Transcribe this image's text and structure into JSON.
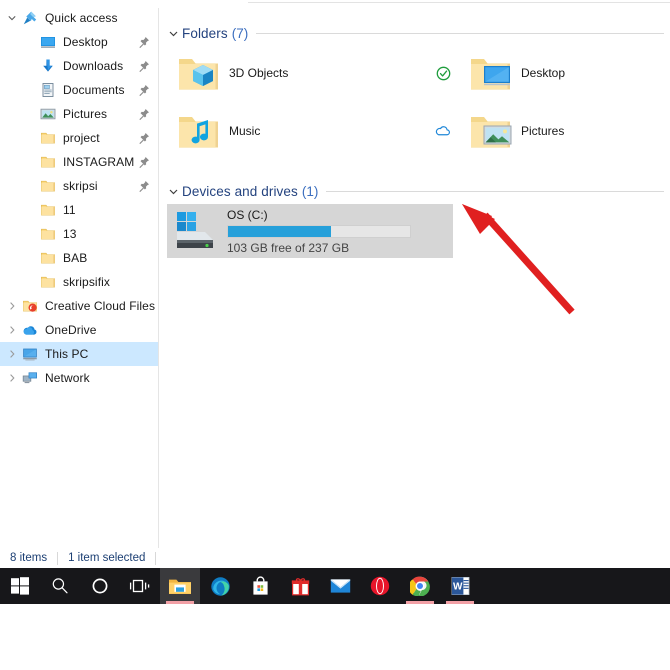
{
  "sidebar": {
    "items": [
      {
        "label": "Quick access",
        "icon": "star-pin-icon",
        "level": 0,
        "chevron": "down",
        "pinned": false,
        "selected": false
      },
      {
        "label": "Desktop",
        "icon": "desktop-icon",
        "level": 1,
        "chevron": "none",
        "pinned": true,
        "selected": false
      },
      {
        "label": "Downloads",
        "icon": "downloads-icon",
        "level": 1,
        "chevron": "none",
        "pinned": true,
        "selected": false
      },
      {
        "label": "Documents",
        "icon": "documents-icon",
        "level": 1,
        "chevron": "none",
        "pinned": true,
        "selected": false
      },
      {
        "label": "Pictures",
        "icon": "pictures-icon",
        "level": 1,
        "chevron": "none",
        "pinned": true,
        "selected": false
      },
      {
        "label": "project",
        "icon": "folder-icon",
        "level": 1,
        "chevron": "none",
        "pinned": true,
        "selected": false
      },
      {
        "label": "INSTAGRAM",
        "icon": "folder-icon",
        "level": 1,
        "chevron": "none",
        "pinned": true,
        "selected": false
      },
      {
        "label": "skripsi",
        "icon": "folder-icon",
        "level": 1,
        "chevron": "none",
        "pinned": true,
        "selected": false
      },
      {
        "label": "11",
        "icon": "folder-icon",
        "level": 1,
        "chevron": "none",
        "pinned": false,
        "selected": false
      },
      {
        "label": "13",
        "icon": "folder-icon",
        "level": 1,
        "chevron": "none",
        "pinned": false,
        "selected": false
      },
      {
        "label": "BAB",
        "icon": "folder-icon",
        "level": 1,
        "chevron": "none",
        "pinned": false,
        "selected": false
      },
      {
        "label": "skripsifix",
        "icon": "folder-icon",
        "level": 1,
        "chevron": "none",
        "pinned": false,
        "selected": false
      },
      {
        "label": "Creative Cloud Files",
        "icon": "creative-cloud-icon",
        "level": 0,
        "chevron": "right",
        "pinned": false,
        "selected": false
      },
      {
        "label": "OneDrive",
        "icon": "onedrive-icon",
        "level": 0,
        "chevron": "right",
        "pinned": false,
        "selected": false
      },
      {
        "label": "This PC",
        "icon": "this-pc-icon",
        "level": 0,
        "chevron": "right",
        "pinned": false,
        "selected": true
      },
      {
        "label": "Network",
        "icon": "network-icon",
        "level": 0,
        "chevron": "right",
        "pinned": false,
        "selected": false
      }
    ]
  },
  "content": {
    "groups": [
      {
        "title": "Folders",
        "count": "(7)",
        "collapsed": false
      },
      {
        "title": "Devices and drives",
        "count": "(1)",
        "collapsed": false
      }
    ],
    "folders": [
      {
        "name": "3D Objects",
        "icon": "folder-3d-objects-icon",
        "cloud_status": "none"
      },
      {
        "name": "Desktop",
        "icon": "folder-desktop-icon",
        "cloud_status": "synced-check"
      },
      {
        "name": "Music",
        "icon": "folder-music-icon",
        "cloud_status": "none"
      },
      {
        "name": "Pictures",
        "icon": "folder-pictures-icon",
        "cloud_status": "online-only-cloud"
      }
    ],
    "drives": [
      {
        "name": "OS (C:)",
        "icon": "windows-hard-drive-icon",
        "free_text": "103 GB free of 237 GB",
        "free_gb": 103,
        "total_gb": 237,
        "used_percent": 56.5,
        "selected": true
      }
    ]
  },
  "status_bar": {
    "item_count": "8 items",
    "selection_count": "1 item selected"
  },
  "annotation": {
    "type": "red-arrow",
    "color": "#e02020",
    "points_to": "OS (C:) drive tile"
  },
  "taskbar": {
    "items": [
      {
        "name": "start-button",
        "icon": "windows-logo-icon",
        "active": false,
        "running": false
      },
      {
        "name": "search-button",
        "icon": "search-icon",
        "active": false,
        "running": false
      },
      {
        "name": "cortana-button",
        "icon": "cortana-circle-icon",
        "active": false,
        "running": false
      },
      {
        "name": "task-view-button",
        "icon": "task-view-icon",
        "active": false,
        "running": false
      },
      {
        "name": "file-explorer-button",
        "icon": "file-explorer-icon",
        "active": true,
        "running": true
      },
      {
        "name": "edge-button",
        "icon": "edge-icon",
        "active": false,
        "running": false
      },
      {
        "name": "microsoft-store-button",
        "icon": "store-bag-icon",
        "active": false,
        "running": false
      },
      {
        "name": "gift-app-button",
        "icon": "gift-box-icon",
        "active": false,
        "running": false
      },
      {
        "name": "mail-button",
        "icon": "mail-envelope-icon",
        "active": false,
        "running": false
      },
      {
        "name": "opera-button",
        "icon": "opera-icon",
        "active": false,
        "running": false
      },
      {
        "name": "chrome-button",
        "icon": "chrome-icon",
        "active": false,
        "running": true
      },
      {
        "name": "word-button",
        "icon": "word-icon",
        "active": false,
        "running": true
      }
    ]
  },
  "colors": {
    "selection_blue": "#cce8ff",
    "tile_selected_gray": "#d6d6d6",
    "progress_blue": "#26a0da",
    "group_header_blue": "#24437f",
    "status_text_blue": "#1c3f73",
    "taskbar_bg": "#17171a",
    "annotation_red": "#e02020",
    "folder_yellow": "#fbd679"
  }
}
